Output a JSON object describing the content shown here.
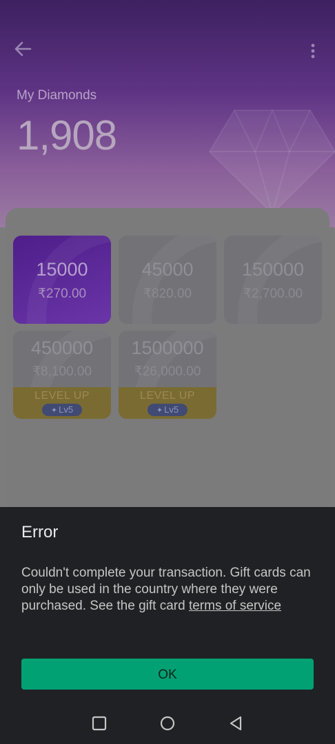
{
  "header": {
    "label": "My Diamonds",
    "value": "1,908"
  },
  "packages": [
    {
      "amount": "15000",
      "price": "₹270.00",
      "selected": true
    },
    {
      "amount": "45000",
      "price": "₹820.00",
      "selected": false
    },
    {
      "amount": "150000",
      "price": "₹2,700.00",
      "selected": false
    },
    {
      "amount": "450000",
      "price": "₹8,100.00",
      "badge": "LEVEL UP",
      "level": "Lv5"
    },
    {
      "amount": "1500000",
      "price": "₹26,000.00",
      "badge": "LEVEL UP",
      "level": "Lv5"
    }
  ],
  "dialog": {
    "title": "Error",
    "message": "Couldn't complete your transaction. Gift cards can only be used in the country where they were purchased. See the gift card ",
    "link_text": "terms of service ",
    "ok_label": "OK"
  },
  "colors": {
    "accent_green": "#01a173",
    "sheet_bg": "#202124",
    "hero_purple": "#5e3384",
    "level_band": "#7a6b33"
  },
  "icons": {
    "back": "arrow-left-icon",
    "menu": "more-vert-icon",
    "nav_recents": "square-icon",
    "nav_home": "circle-icon",
    "nav_back": "triangle-back-icon"
  }
}
